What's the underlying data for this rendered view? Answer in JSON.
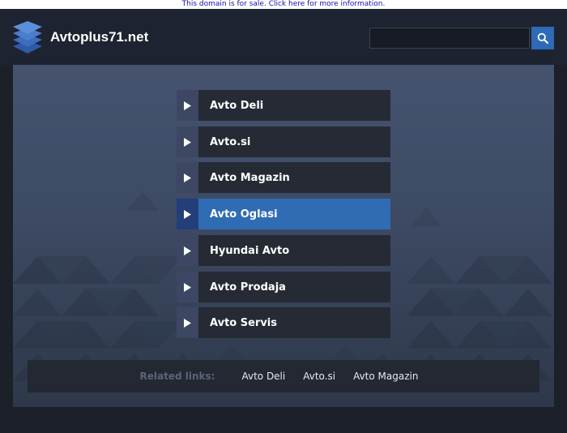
{
  "banner": {
    "text": "This domain is for sale. Click here for more information."
  },
  "header": {
    "site_title": "Avtoplus71.net",
    "logo_icon": "stacked-layers-icon",
    "search": {
      "value": "",
      "placeholder": "",
      "button_icon": "search-icon"
    }
  },
  "menu": {
    "arrow_icon": "play-triangle-icon",
    "items": [
      {
        "label": "Avto Deli",
        "active": false
      },
      {
        "label": "Avto.si",
        "active": false
      },
      {
        "label": "Avto Magazin",
        "active": false
      },
      {
        "label": "Avto Oglasi",
        "active": true
      },
      {
        "label": "Hyundai Avto",
        "active": false
      },
      {
        "label": "Avto Prodaja",
        "active": false
      },
      {
        "label": "Avto Servis",
        "active": false
      }
    ]
  },
  "related": {
    "title": "Related links:",
    "links": [
      "Avto Deli",
      "Avto.si",
      "Avto Magazin"
    ]
  },
  "colors": {
    "accent": "#2f6cb3",
    "page_background": "#1b2029",
    "header_background": "#1d2330",
    "menu_item_background": "#252a34",
    "menu_arrow_background": "#3d4763"
  }
}
